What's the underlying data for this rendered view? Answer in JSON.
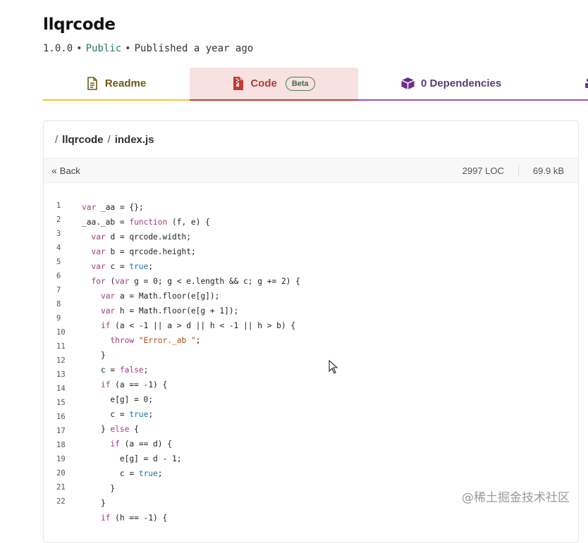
{
  "package": {
    "name": "llqrcode",
    "version": "1.0.0",
    "bullet": "•",
    "visibility": "Public",
    "published": "Published a year ago"
  },
  "tabs": {
    "readme": {
      "label": "Readme",
      "icon": "readme-icon"
    },
    "code": {
      "label": "Code",
      "badge": "Beta",
      "icon": "file-zip-icon"
    },
    "dependencies": {
      "label": "0 Dependencies",
      "icon": "box-icon"
    }
  },
  "breadcrumb": {
    "separator": "/",
    "package": "llqrcode",
    "file": "index.js"
  },
  "file_bar": {
    "back_glyph": "«",
    "back_label": "Back",
    "loc": "2997 LOC",
    "size": "69.9 kB"
  },
  "code_lines": [
    {
      "n": "1",
      "tokens": [
        {
          "k": "kw",
          "t": "var"
        },
        {
          "k": "",
          "t": " _aa = {};"
        }
      ]
    },
    {
      "n": "2",
      "tokens": [
        {
          "k": "",
          "t": "_aa._ab = "
        },
        {
          "k": "kw",
          "t": "function"
        },
        {
          "k": "",
          "t": " (f, e) {"
        }
      ]
    },
    {
      "n": "3",
      "tokens": [
        {
          "k": "",
          "t": "  "
        },
        {
          "k": "kw",
          "t": "var"
        },
        {
          "k": "",
          "t": " d = qrcode.width;"
        }
      ]
    },
    {
      "n": "4",
      "tokens": [
        {
          "k": "",
          "t": "  "
        },
        {
          "k": "kw",
          "t": "var"
        },
        {
          "k": "",
          "t": " b = qrcode.height;"
        }
      ]
    },
    {
      "n": "5",
      "tokens": [
        {
          "k": "",
          "t": "  "
        },
        {
          "k": "kw",
          "t": "var"
        },
        {
          "k": "",
          "t": " c = "
        },
        {
          "k": "lit",
          "t": "true"
        },
        {
          "k": "",
          "t": ";"
        }
      ]
    },
    {
      "n": "6",
      "tokens": [
        {
          "k": "",
          "t": "  "
        },
        {
          "k": "kw",
          "t": "for"
        },
        {
          "k": "",
          "t": " ("
        },
        {
          "k": "kw",
          "t": "var"
        },
        {
          "k": "",
          "t": " g = 0; g < e.length && c; g += 2) {"
        }
      ]
    },
    {
      "n": "7",
      "tokens": [
        {
          "k": "",
          "t": "    "
        },
        {
          "k": "kw",
          "t": "var"
        },
        {
          "k": "",
          "t": " a = Math.floor(e[g]);"
        }
      ]
    },
    {
      "n": "8",
      "tokens": [
        {
          "k": "",
          "t": "    "
        },
        {
          "k": "kw",
          "t": "var"
        },
        {
          "k": "",
          "t": " h = Math.floor(e[g + 1]);"
        }
      ]
    },
    {
      "n": "9",
      "tokens": [
        {
          "k": "",
          "t": "    "
        },
        {
          "k": "kw",
          "t": "if"
        },
        {
          "k": "",
          "t": " (a < -1 || a > d || h < -1 || h > b) {"
        }
      ]
    },
    {
      "n": "10",
      "tokens": [
        {
          "k": "",
          "t": "      "
        },
        {
          "k": "kw",
          "t": "throw"
        },
        {
          "k": "",
          "t": " "
        },
        {
          "k": "str",
          "t": "\"Error._ab \""
        },
        {
          "k": "",
          "t": ";"
        }
      ]
    },
    {
      "n": "11",
      "tokens": [
        {
          "k": "",
          "t": "    }"
        }
      ]
    },
    {
      "n": "12",
      "tokens": [
        {
          "k": "",
          "t": "    c = "
        },
        {
          "k": "kw",
          "t": "false"
        },
        {
          "k": "",
          "t": ";"
        }
      ]
    },
    {
      "n": "13",
      "tokens": [
        {
          "k": "",
          "t": "    "
        },
        {
          "k": "kw",
          "t": "if"
        },
        {
          "k": "",
          "t": " (a == -1) {"
        }
      ]
    },
    {
      "n": "14",
      "tokens": [
        {
          "k": "",
          "t": "      e[g] = 0;"
        }
      ]
    },
    {
      "n": "15",
      "tokens": [
        {
          "k": "",
          "t": "      c = "
        },
        {
          "k": "lit",
          "t": "true"
        },
        {
          "k": "",
          "t": ";"
        }
      ]
    },
    {
      "n": "16",
      "tokens": [
        {
          "k": "",
          "t": "    } "
        },
        {
          "k": "kw",
          "t": "else"
        },
        {
          "k": "",
          "t": " {"
        }
      ]
    },
    {
      "n": "17",
      "tokens": [
        {
          "k": "",
          "t": "      "
        },
        {
          "k": "kw",
          "t": "if"
        },
        {
          "k": "",
          "t": " (a == d) {"
        }
      ]
    },
    {
      "n": "18",
      "tokens": [
        {
          "k": "",
          "t": "        e[g] = d - 1;"
        }
      ]
    },
    {
      "n": "19",
      "tokens": [
        {
          "k": "",
          "t": "        c = "
        },
        {
          "k": "lit",
          "t": "true"
        },
        {
          "k": "",
          "t": ";"
        }
      ]
    },
    {
      "n": "20",
      "tokens": [
        {
          "k": "",
          "t": "      }"
        }
      ]
    },
    {
      "n": "21",
      "tokens": [
        {
          "k": "",
          "t": "    }"
        }
      ]
    },
    {
      "n": "22",
      "tokens": [
        {
          "k": "",
          "t": "    "
        },
        {
          "k": "kw",
          "t": "if"
        },
        {
          "k": "",
          "t": " (h == -1) {"
        }
      ]
    }
  ],
  "watermark": "@稀土掘金技术社区",
  "colors": {
    "keyword": "#a33b84",
    "literal": "#1f72a6",
    "string": "#b34a15",
    "readme_accent": "#f2c230",
    "code_accent": "#c43a33",
    "deps_accent": "#9b4ec6",
    "public": "#2f7a64"
  }
}
